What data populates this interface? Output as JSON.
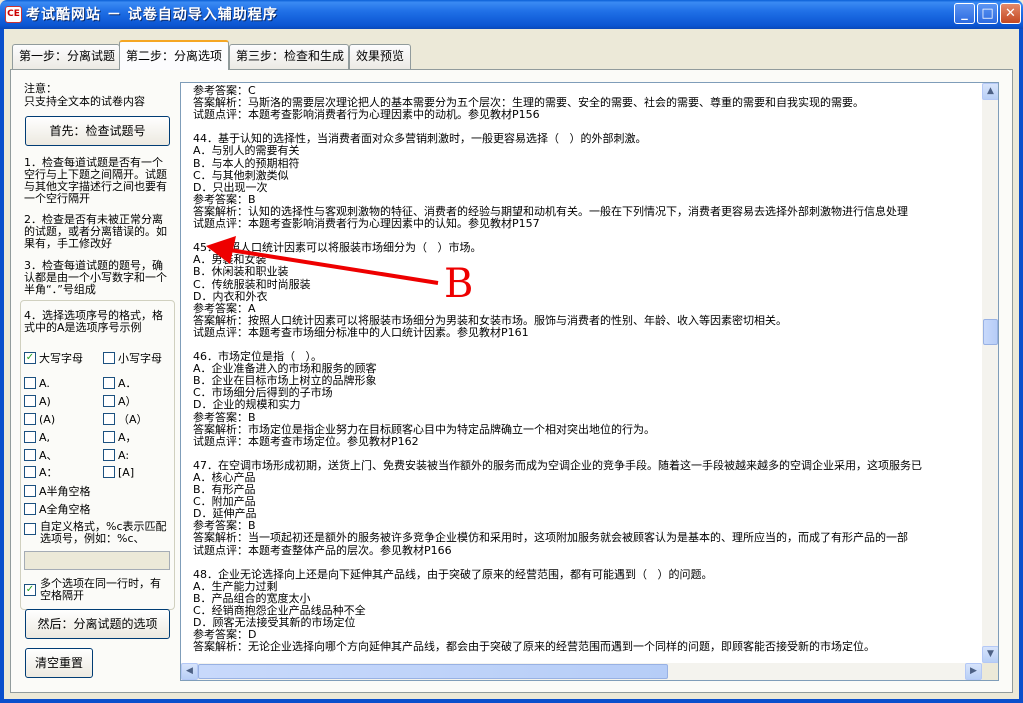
{
  "window": {
    "title": "考试酷网站 － 试卷自动导入辅助程序",
    "icon_text": "CE",
    "controls": {
      "minimize": "_",
      "maximize": "□",
      "close": "✕"
    }
  },
  "tabs": [
    {
      "label": "第一步：分离试题"
    },
    {
      "label": "第二步：分离选项"
    },
    {
      "label": "第三步：检查和生成"
    },
    {
      "label": "效果预览"
    }
  ],
  "left_panel": {
    "notice_title": "注意：",
    "notice_text": "只支持全文本的试卷内容",
    "check_button": "首先：检查试题号",
    "steps": [
      "1．检查每道试题是否有一个空行与上下题之间隔开。试题与其他文字描述行之间也要有一个空行隔开",
      "2．检查是否有未被正常分离的试题，或者分离错误的。如果有，手工修改好",
      "3．检查每道试题的题号，确认都是由一个小写数字和一个半角“．”号组成"
    ],
    "format_hint": "4．选择选项序号的格式，格式中的A是选项序号示例",
    "options": [
      {
        "label": "大写字母",
        "checked": true
      },
      {
        "label": "小写字母",
        "checked": false
      },
      {
        "label": "A.",
        "checked": false
      },
      {
        "label": "A．",
        "checked": false
      },
      {
        "label": "A)",
        "checked": false
      },
      {
        "label": "A）",
        "checked": false
      },
      {
        "label": "(A)",
        "checked": false
      },
      {
        "label": "（A）",
        "checked": false
      },
      {
        "label": "A,",
        "checked": false
      },
      {
        "label": "A，",
        "checked": false
      },
      {
        "label": "A、",
        "checked": false
      },
      {
        "label": "A:",
        "checked": false
      },
      {
        "label": "A：",
        "checked": false
      },
      {
        "label": "[A]",
        "checked": false
      },
      {
        "label": "A半角空格",
        "checked": false
      },
      {
        "label": "A全角空格",
        "checked": false
      },
      {
        "label": "自定义格式，%c表示匹配选项号，例如：%c、",
        "checked": false
      },
      {
        "label": "多个选项在同一行时，有空格隔开",
        "checked": true
      }
    ],
    "custom_format_value": "",
    "split_button": "然后：分离试题的选项",
    "reset_button": "清空重置"
  },
  "content_lines": [
    "参考答案：C",
    "答案解析：马斯洛的需要层次理论把人的基本需要分为五个层次：生理的需要、安全的需要、社会的需要、尊重的需要和自我实现的需要。",
    "试题点评：本题考查影响消费者行为心理因素中的动机。参见教材P156",
    "",
    "44．基于认知的选择性，当消费者面对众多营销刺激时，一般更容易选择（   ）的外部刺激。",
    "A．与别人的需要有关",
    "B．与本人的预期相符",
    "C．与其他刺激类似",
    "D．只出现一次",
    "参考答案：B",
    "答案解析：认知的选择性与客观刺激物的特征、消费者的经验与期望和动机有关。一般在下列情况下，消费者更容易去选择外部刺激物进行信息处理",
    "试题点评：本题考查影响消费者行为心理因素中的认知。参见教材P157",
    "",
    "45．按照人口统计因素可以将服装市场细分为（   ）市场。",
    "A．男装和女装",
    "B．休闲装和职业装",
    "C．传统服装和时尚服装",
    "D．内衣和外衣",
    "参考答案：A",
    "答案解析：按照人口统计因素可以将服装市场细分为男装和女装市场。服饰与消费者的性别、年龄、收入等因素密切相关。",
    "试题点评：本题考查市场细分标准中的人口统计因素。参见教材P161",
    "",
    "46．市场定位是指（   ）。",
    "A．企业准备进入的市场和服务的顾客",
    "B．企业在目标市场上树立的品牌形象",
    "C．市场细分后得到的子市场",
    "D．企业的规模和实力",
    "参考答案：B",
    "答案解析：市场定位是指企业努力在目标顾客心目中为特定品牌确立一个相对突出地位的行为。",
    "试题点评：本题考查市场定位。参见教材P162",
    "",
    "47．在空调市场形成初期，送货上门、免费安装被当作额外的服务而成为空调企业的竞争手段。随着这一手段被越来越多的空调企业采用，这项服务已",
    "A．核心产品",
    "B．有形产品",
    "C．附加产品",
    "D．延伸产品",
    "参考答案：B",
    "答案解析：当一项起初还是额外的服务被许多竞争企业模仿和采用时，这项附加服务就会被顾客认为是基本的、理所应当的，而成了有形产品的一部",
    "试题点评：本题考查整体产品的层次。参见教材P166",
    "",
    "48．企业无论选择向上还是向下延伸其产品线，由于突破了原来的经营范围，都有可能遇到（   ）的问题。",
    "A．生产能力过剩",
    "B．产品组合的宽度太小",
    "C．经销商抱怨企业产品线品种不全",
    "D．顾客无法接受其新的市场定位",
    "参考答案：D",
    "答案解析：无论企业选择向哪个方向延伸其产品线，都会由于突破了原来的经营范围而遇到一个同样的问题，即顾客能否接受新的市场定位。"
  ],
  "annotation": {
    "label": "B",
    "color": "#ee0000"
  }
}
